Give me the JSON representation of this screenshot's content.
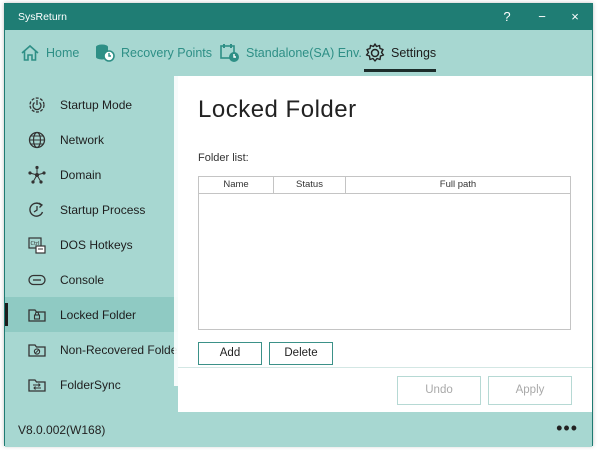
{
  "window": {
    "title": "SysReturn"
  },
  "titlebar": {
    "help": "?",
    "minimize": "−",
    "close": "×"
  },
  "nav": {
    "items": [
      {
        "label": "Home",
        "icon": "home-icon"
      },
      {
        "label": "Recovery Points",
        "icon": "recovery-points-icon"
      },
      {
        "label": "Standalone(SA) Env.",
        "icon": "standalone-icon"
      },
      {
        "label": "Settings",
        "icon": "gear-icon",
        "active": true
      }
    ]
  },
  "sidebar": {
    "items": [
      {
        "label": "Startup Mode",
        "icon": "startup-mode-icon"
      },
      {
        "label": "Network",
        "icon": "globe-icon"
      },
      {
        "label": "Domain",
        "icon": "domain-icon"
      },
      {
        "label": "Startup Process",
        "icon": "startup-process-icon"
      },
      {
        "label": "DOS Hotkeys",
        "icon": "keyboard-icon"
      },
      {
        "label": "Console",
        "icon": "console-icon"
      },
      {
        "label": "Locked Folder",
        "icon": "locked-folder-icon",
        "active": true
      },
      {
        "label": "Non-Recovered Folder",
        "icon": "non-recovered-folder-icon"
      },
      {
        "label": "FolderSync",
        "icon": "folder-sync-icon"
      }
    ]
  },
  "main": {
    "title": "Locked Folder",
    "folder_list_label": "Folder list:",
    "columns": [
      "Name",
      "Status",
      "Full path"
    ],
    "rows": [],
    "add_label": "Add",
    "delete_label": "Delete",
    "undo_label": "Undo",
    "apply_label": "Apply"
  },
  "footer": {
    "version": "V8.0.002(W168)",
    "more": "•••"
  },
  "colors": {
    "accent": "#1f7d74",
    "panel": "#a7d7d1",
    "nav_text": "#2e8f86"
  }
}
